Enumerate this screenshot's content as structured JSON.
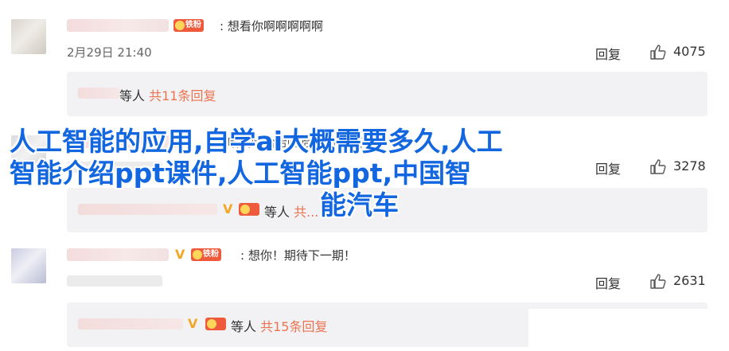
{
  "comments": [
    {
      "text": ": 想看你啊啊啊啊啊",
      "fan_badge": "铁粉",
      "timestamp": "2月29日 21:40",
      "reply_label": "回复",
      "like_count": "4075",
      "replies_who": "等人",
      "replies_count": "共11条回复"
    },
    {
      "text": ": 哈哈哈哈哈哈哈 娜你不笑",
      "fan_badge": "",
      "timestamp": "",
      "reply_label": "回复",
      "like_count": "3278",
      "replies_who": "等人",
      "replies_count": "共..."
    },
    {
      "text": ": 想你！期待下一期！",
      "fan_badge": "铁粉",
      "timestamp": "",
      "reply_label": "回复",
      "like_count": "2631",
      "replies_who": "等人",
      "replies_count": "共15条回复"
    }
  ],
  "overlay": {
    "line1": "人工智能的应用,自学ai大概需要多久,人工",
    "line2": "智能介绍ppt课件,人工智能ppt,中国智",
    "line3": "能汽车"
  },
  "colors": {
    "overlay_text": "#1266e0",
    "reply_count": "#eb7350",
    "fan_badge": "#f05a3c",
    "v_badge": "#f5a623"
  },
  "icons": {
    "like": "thumbs-up-icon",
    "vip": "v-badge-icon",
    "fan": "fan-badge-icon"
  }
}
